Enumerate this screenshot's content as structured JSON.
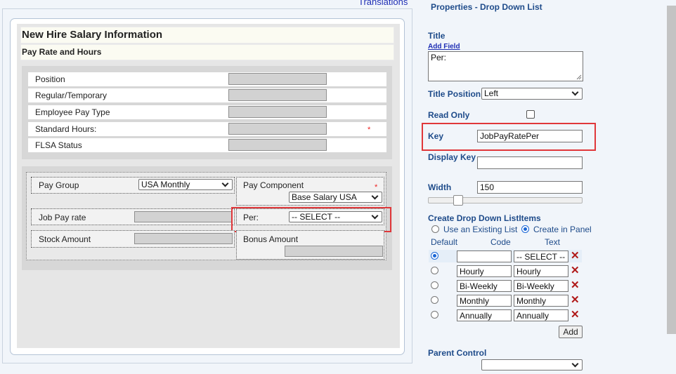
{
  "form": {
    "translations_link": "Translations",
    "title": "New Hire Salary Information",
    "subtitle": "Pay Rate and Hours",
    "section1_rows": [
      {
        "label": "Position",
        "required": false
      },
      {
        "label": "Regular/Temporary",
        "required": false
      },
      {
        "label": "Employee Pay Type",
        "required": false
      },
      {
        "label": "Standard Hours:",
        "required": true
      },
      {
        "label": "FLSA Status",
        "required": false
      }
    ],
    "required_mark": "*",
    "pay_group": {
      "label": "Pay Group",
      "value": "USA Monthly"
    },
    "pay_component": {
      "label": "Pay Component",
      "value": "Base Salary USA"
    },
    "job_pay_rate": {
      "label": "Job Pay rate"
    },
    "per": {
      "label": "Per:",
      "value": "-- SELECT --"
    },
    "stock_amount": {
      "label": "Stock Amount"
    },
    "bonus_amount": {
      "label": "Bonus Amount"
    }
  },
  "properties": {
    "header": "Properties - Drop Down List",
    "title_label": "Title",
    "add_field_link": "Add Field",
    "title_value": "Per:",
    "title_position_label": "Title Position",
    "title_position_value": "Left",
    "read_only_label": "Read Only",
    "read_only_checked": false,
    "key_label": "Key",
    "key_value": "JobPayRatePer",
    "display_key_label": "Display Key",
    "display_key_value": "",
    "width_label": "Width",
    "width_value": "150",
    "width_slider_fraction": 0.19,
    "create_items_label": "Create Drop Down ListItems",
    "use_existing_label": "Use an Existing List",
    "create_in_panel_label": "Create in Panel",
    "mode_selected": "create_in_panel",
    "columns": {
      "default": "Default",
      "code": "Code",
      "text": "Text"
    },
    "items": [
      {
        "code": "",
        "text": "-- SELECT --",
        "default": true
      },
      {
        "code": "Hourly",
        "text": "Hourly",
        "default": false
      },
      {
        "code": "Bi-Weekly",
        "text": "Bi-Weekly",
        "default": false
      },
      {
        "code": "Monthly",
        "text": "Monthly",
        "default": false
      },
      {
        "code": "Annually",
        "text": "Annually",
        "default": false
      }
    ],
    "add_button": "Add",
    "parent_control_label": "Parent Control",
    "parent_control_value": ""
  },
  "colors": {
    "label_blue": "#1e4b8a",
    "highlight_red": "#e0373a",
    "delete_red": "#b01818",
    "required_red": "#e22"
  },
  "icons": [
    "chevron-down-icon",
    "delete-x-icon",
    "resize-grip-icon"
  ]
}
